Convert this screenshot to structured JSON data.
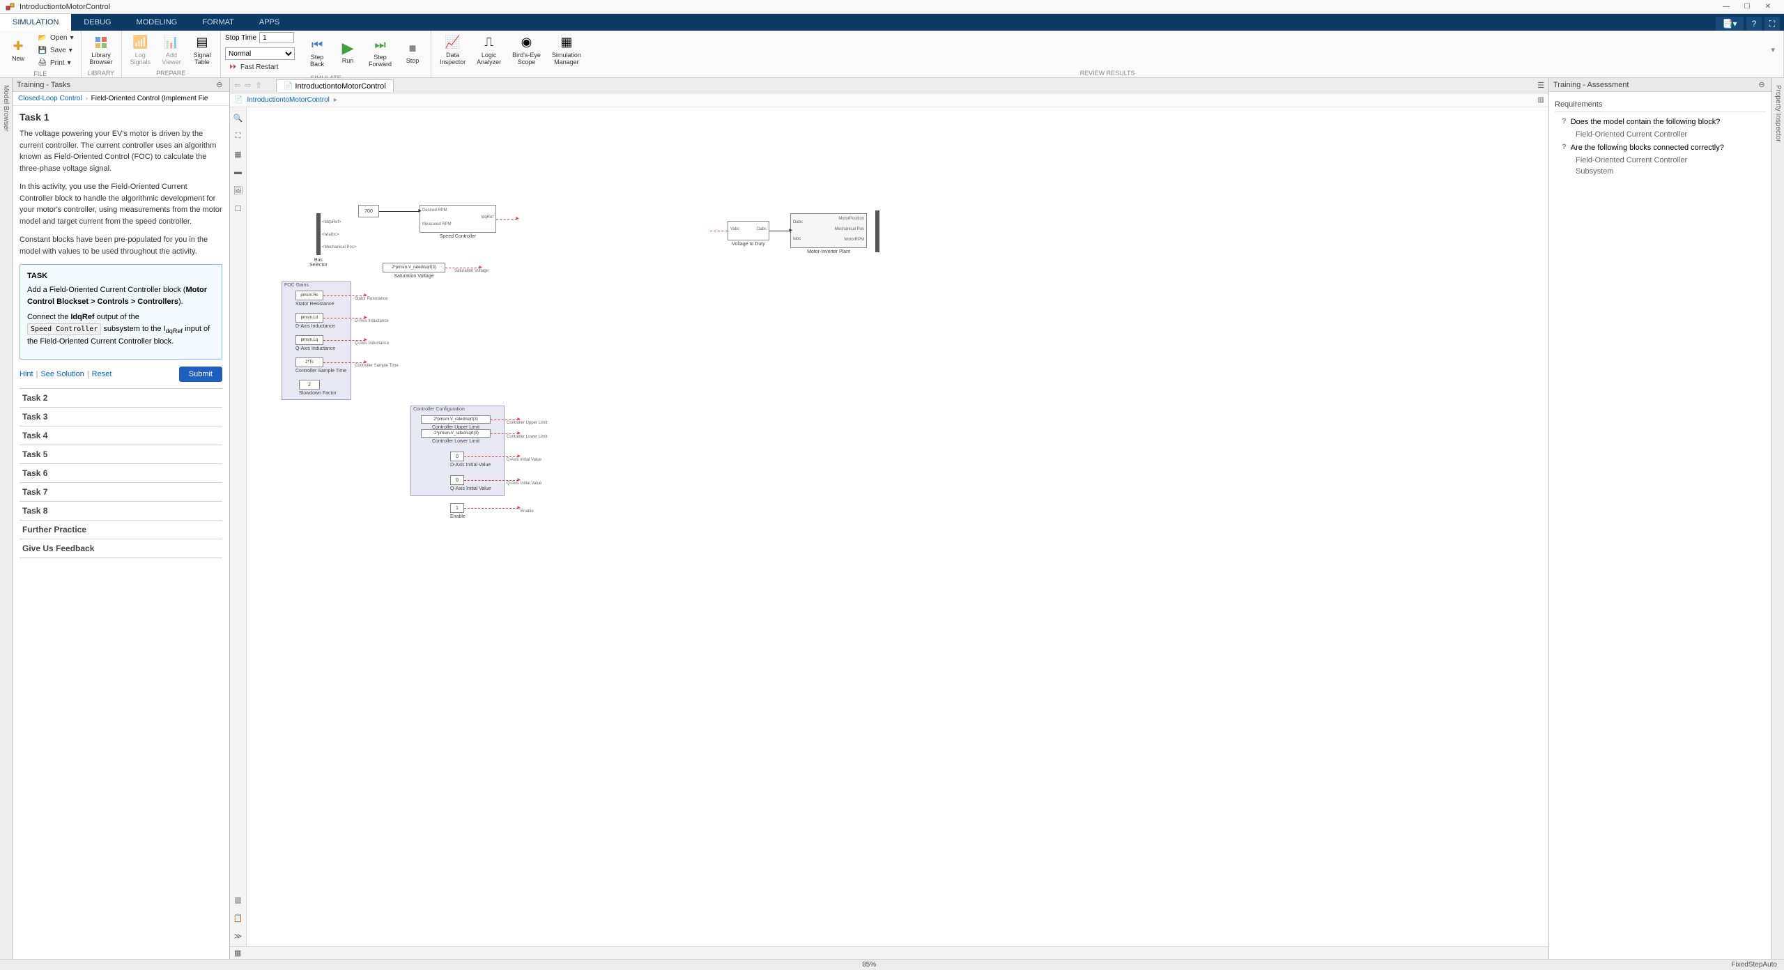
{
  "titlebar": {
    "title": "IntroductiontoMotorControl"
  },
  "ribbonTabs": {
    "tabs": [
      "SIMULATION",
      "DEBUG",
      "MODELING",
      "FORMAT",
      "APPS"
    ],
    "active": 0
  },
  "toolstrip": {
    "file": {
      "label": "FILE",
      "new": "New",
      "open": "Open",
      "save": "Save",
      "print": "Print"
    },
    "library": {
      "label": "LIBRARY",
      "browser": "Library\nBrowser"
    },
    "prepare": {
      "label": "PREPARE",
      "logSignals": "Log\nSignals",
      "addViewer": "Add\nViewer",
      "signalTable": "Signal\nTable"
    },
    "simulate": {
      "label": "SIMULATE",
      "stopTimeLbl": "Stop Time",
      "stopTime": "1",
      "mode": "Normal",
      "fastRestart": "Fast Restart",
      "stepBack": "Step\nBack",
      "run": "Run",
      "stepForward": "Step\nForward",
      "stop": "Stop"
    },
    "review": {
      "label": "REVIEW RESULTS",
      "dataInspector": "Data\nInspector",
      "logicAnalyzer": "Logic\nAnalyzer",
      "birdsEye": "Bird's-Eye\nScope",
      "simManager": "Simulation\nManager"
    }
  },
  "leftCollapsed": "Model Browser",
  "rightCollapsed": "Property Inspector",
  "tasksPanel": {
    "title": "Training - Tasks",
    "breadcrumb": {
      "a": "Closed-Loop Control",
      "b": "Field-Oriented Control (Implement Fie"
    },
    "task1": {
      "title": "Task 1",
      "p1": "The voltage powering your EV's motor is driven by the current controller. The current controller uses an algorithm known as Field-Oriented Control (FOC) to calculate the three-phase voltage signal.",
      "p2": "In this activity, you use the Field-Oriented Current Controller block to handle the algorithmic development for your motor's controller, using measurements from the motor model and target current from the speed controller.",
      "p3": "Constant blocks have been pre-populated for you in the model with values to be used throughout the activity.",
      "boxTitle": "TASK",
      "box1a": "Add a Field-Oriented Current Controller block (",
      "box1b": "Motor Control Blockset > Controls > Controllers",
      "box1c": ").",
      "box2a": "Connect the ",
      "box2b": "IdqRef",
      "box2c": " output of the ",
      "box2d": "Speed Controller",
      "box2e": " subsystem to the I",
      "box2f": "dqRef",
      "box2g": " input of the Field-Oriented Current Controller block.",
      "hint": "Hint",
      "seeSolution": "See Solution",
      "reset": "Reset",
      "submit": "Submit"
    },
    "otherTasks": [
      "Task 2",
      "Task 3",
      "Task 4",
      "Task 5",
      "Task 6",
      "Task 7",
      "Task 8",
      "Further Practice",
      "Give Us Feedback"
    ]
  },
  "canvas": {
    "tab": "IntroductiontoMotorControl",
    "crumb": "IntroductiontoMotorControl",
    "zoom": "85%",
    "blocks": {
      "desiredRpmConst": "700",
      "desiredRpm": "Desired RPM",
      "measuredRpm": "Measured RPM",
      "idqsRef": "<IdqsRef>",
      "wIaIbc": "<wIaIbc>",
      "mechPos": "<Mechanical Pos>",
      "busSelector": "Bus\nSelector",
      "speedController": "Speed Controller",
      "idqRefOut": "IdqRef",
      "satVoltageVal": "2*pmsm.V_rated/sqrt(3)",
      "satVoltage": "Saturation Voltage",
      "satVoltageSig": "Saturation Voltage",
      "voltageToDuty": "Voltage to Duty",
      "vabcIn": "Vabc",
      "dabcOut": "Dabc",
      "motorInverter": "Motor-Inverter Plant",
      "mipDabc": "Dabc",
      "mipIabc": "Iabc",
      "mipMotorPos": "MotorPosition",
      "mipMechPos": "Mechanical Pos",
      "mipMotorRpm": "MotorRPM",
      "focGains": "FOC Gains",
      "pmsmRs": "pmsm.Rs",
      "statorRes": "Stator Resistance",
      "statorResSig": "Stator Resistance",
      "pmsmLd": "pmsm.Ld",
      "dAxisInd": "D-Axis Inductance",
      "dAxisIndSig": "D-Axis Inductance",
      "pmsmLq": "pmsm.Lq",
      "qAxisInd": "Q-Axis Inductance",
      "qAxisIndSig": "Q-Axis Inductance",
      "twoTs": "2*Ts",
      "ctrlSample": "Controller Sample Time",
      "ctrlSampleSig": "Controller Sample Time",
      "two": "2",
      "slowdown": "Slowdown Factor",
      "ctrlConfig": "Controller Configuration",
      "upperLimVal": "2*pmsm.V_rated/sqrt(3)",
      "upperLim": "Controller Upper Limit",
      "upperLimSig": "Controller Upper Limit",
      "lowerLimVal": "-2*pmsm.V_rated/sqrt(3)",
      "lowerLim": "Controller Lower Limit",
      "lowerLimSig": "Controller Lower Limit",
      "zero1": "0",
      "dAxisInit": "D-Axis Initial Value",
      "dAxisInitSig": "D-Axis Initial Value",
      "zero2": "0",
      "qAxisInit": "Q-Axis Initial Value",
      "qAxisInitSig": "Q-Axis Initial Value",
      "one": "1",
      "enable": "Enable",
      "enableSig": "Enable"
    }
  },
  "assessment": {
    "title": "Training - Assessment",
    "reqTitle": "Requirements",
    "r1": "Does the model contain the following block?",
    "r1sub": "Field-Oriented Current Controller",
    "r2": "Are the following blocks connected correctly?",
    "r2sub1": "Field-Oriented Current Controller",
    "r2sub2": "Subsystem"
  },
  "statusbar": {
    "solver": "FixedStepAuto"
  }
}
